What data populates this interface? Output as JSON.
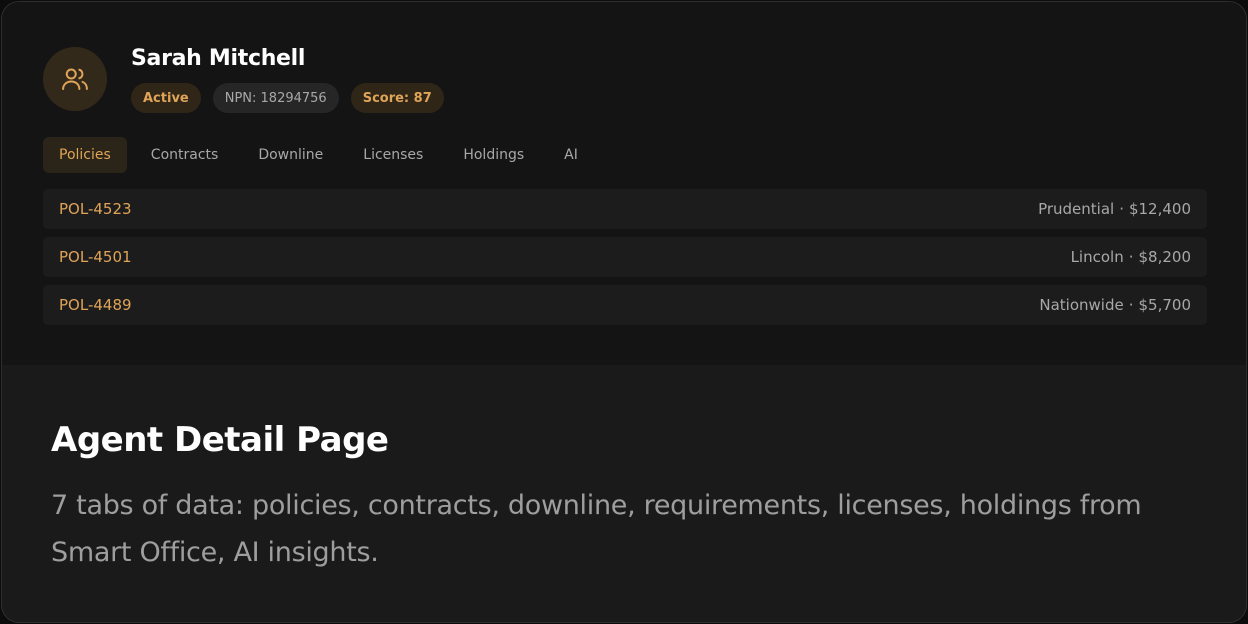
{
  "agent": {
    "name": "Sarah Mitchell",
    "status": "Active",
    "npn": "NPN: 18294756",
    "score": "Score: 87",
    "avatar_icon": "users-icon"
  },
  "tabs": [
    {
      "label": "Policies",
      "active": true
    },
    {
      "label": "Contracts",
      "active": false
    },
    {
      "label": "Downline",
      "active": false
    },
    {
      "label": "Licenses",
      "active": false
    },
    {
      "label": "Holdings",
      "active": false
    },
    {
      "label": "AI",
      "active": false
    }
  ],
  "policies": [
    {
      "id": "POL-4523",
      "carrier": "Prudential",
      "separator": "·",
      "amount": "$12,400"
    },
    {
      "id": "POL-4501",
      "carrier": "Lincoln",
      "separator": "·",
      "amount": "$8,200"
    },
    {
      "id": "POL-4489",
      "carrier": "Nationwide",
      "separator": "·",
      "amount": "$5,700"
    }
  ],
  "caption": {
    "title": "Agent Detail Page",
    "description": "7 tabs of data: policies, contracts, downline, requirements, licenses, holdings from Smart Office, AI insights."
  },
  "colors": {
    "accent": "#e0a458",
    "background": "#1a1a1a",
    "panel": "#141414"
  }
}
